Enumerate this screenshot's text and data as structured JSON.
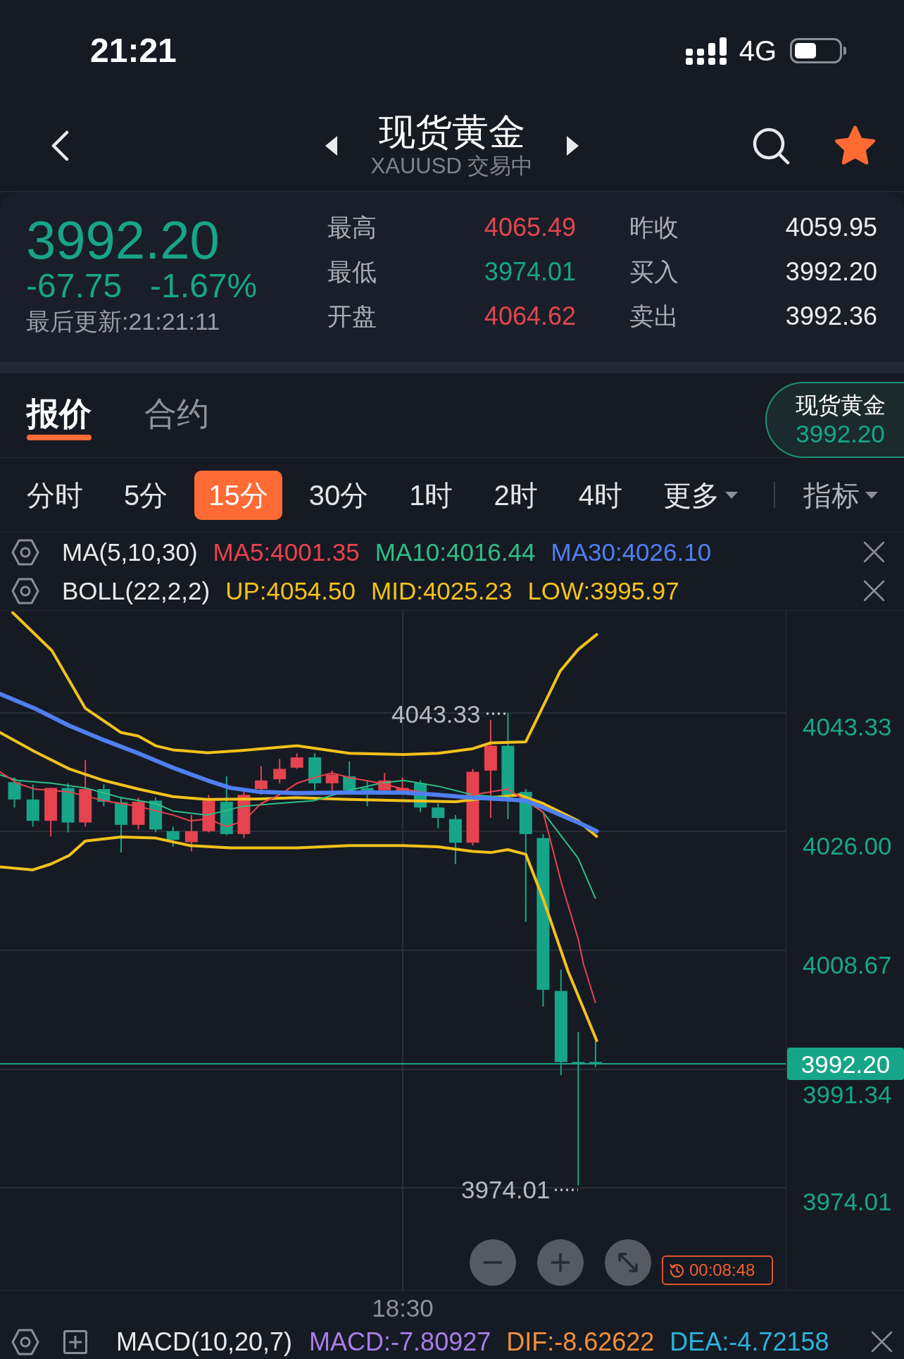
{
  "status_bar": {
    "time": "21:21",
    "network": "4G"
  },
  "header": {
    "title": "现货黄金",
    "subtitle": "XAUUSD 交易中",
    "favorite": true
  },
  "quote": {
    "falling": true,
    "price": "3992.20",
    "change": "-67.75",
    "change_percent": "-1.67%",
    "updated": "最后更新:21:21:11",
    "stats": [
      {
        "label": "最高",
        "value": "4065.49",
        "color": "#e0474f"
      },
      {
        "label": "昨收",
        "value": "4059.95",
        "color": "#eceef2"
      },
      {
        "label": "最低",
        "value": "3974.01",
        "color": "#17a589"
      },
      {
        "label": "买入",
        "value": "3992.20",
        "color": "#eceef2"
      },
      {
        "label": "开盘",
        "value": "4064.62",
        "color": "#e0474f"
      },
      {
        "label": "卖出",
        "value": "3992.36",
        "color": "#eceef2"
      }
    ]
  },
  "tabs": [
    {
      "label": "报价",
      "selected": true
    },
    {
      "label": "合约",
      "selected": false
    }
  ],
  "quote_pill": {
    "name": "现货黄金",
    "price": "3992.20"
  },
  "intervals": [
    {
      "label": "分时",
      "kind": "option",
      "selected": false
    },
    {
      "label": "5分",
      "kind": "option",
      "selected": false
    },
    {
      "label": "15分",
      "kind": "option",
      "selected": true
    },
    {
      "label": "30分",
      "kind": "option",
      "selected": false
    },
    {
      "label": "1时",
      "kind": "option",
      "selected": false
    },
    {
      "label": "2时",
      "kind": "option",
      "selected": false
    },
    {
      "label": "4时",
      "kind": "option",
      "selected": false
    },
    {
      "label": "更多",
      "kind": "dropdown",
      "selected": false
    }
  ],
  "indicator_menu": {
    "label": "指标"
  },
  "indicators": [
    {
      "name": "MA(5,10,30)",
      "values": [
        {
          "text": "MA5:4001.35",
          "color": "#e8434f"
        },
        {
          "text": "MA10:4016.44",
          "color": "#2fbf84"
        },
        {
          "text": "MA30:4026.10",
          "color": "#4f7ff0"
        }
      ]
    },
    {
      "name": "BOLL(22,2,2)",
      "values": [
        {
          "text": "UP:4054.50",
          "color": "#f2c21b"
        },
        {
          "text": "MID:4025.23",
          "color": "#f2c21b"
        },
        {
          "text": "LOW:3995.97",
          "color": "#f2c21b"
        }
      ]
    }
  ],
  "chart": {
    "price_axis": [
      "4043.33",
      "4026.00",
      "4008.67",
      "3991.34",
      "3974.01"
    ],
    "time_axis": [
      "18:30"
    ],
    "high_marker": "4043.33",
    "low_marker": "3974.01",
    "last_price": "3992.20",
    "countdown": "00:08:48"
  },
  "macd": {
    "name": "MACD(10,20,7)",
    "values": [
      {
        "text": "MACD:-7.80927",
        "color": "#a77ee8"
      },
      {
        "text": "DIF:-8.62622",
        "color": "#f0903c"
      },
      {
        "text": "DEA:-4.72158",
        "color": "#2ab4dc"
      }
    ]
  }
}
